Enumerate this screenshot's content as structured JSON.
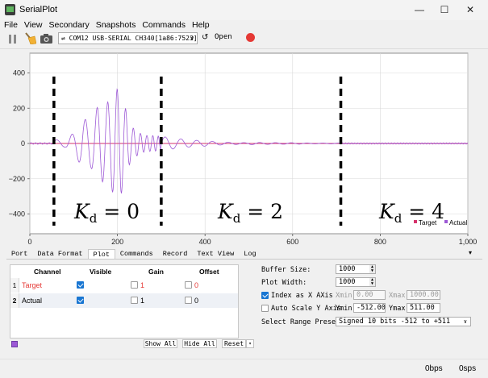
{
  "window": {
    "title": "SerialPlot"
  },
  "menu": [
    "File",
    "View",
    "Secondary",
    "Snapshots",
    "Commands",
    "Help"
  ],
  "toolbar": {
    "port_value": "COM12 USB-SERIAL CH340[1a86:7523]",
    "open_label": "Open",
    "refresh_glyph": "↺"
  },
  "window_controls": {
    "minimize": "—",
    "maximize": "☐",
    "close": "✕"
  },
  "plot": {
    "y_ticks": [
      "400",
      "200",
      "0",
      "−200",
      "−400"
    ],
    "x_ticks": [
      "0",
      "200",
      "400",
      "600",
      "800",
      "1,000"
    ],
    "annotations": [
      {
        "subscript": "d",
        "value": "0"
      },
      {
        "subscript": "d",
        "value": "2"
      },
      {
        "subscript": "d",
        "value": "4"
      }
    ],
    "legend": {
      "target": "Target",
      "actual": "Actual"
    }
  },
  "chart_data": {
    "type": "line",
    "xlim": [
      0,
      1000
    ],
    "ylim": [
      -512,
      512
    ],
    "series": [
      {
        "name": "Target",
        "color": "#d6336c",
        "x": [
          0,
          1000
        ],
        "y": [
          0,
          0
        ]
      },
      {
        "name": "Actual",
        "color": "#9d59d6",
        "x": [
          55,
          80,
          100,
          120,
          140,
          155,
          175,
          195,
          205,
          215,
          230,
          250,
          265,
          280,
          300,
          320,
          340,
          360,
          380,
          400,
          420,
          440,
          460,
          500,
          550,
          600,
          650,
          700,
          710,
          800,
          900,
          1000
        ],
        "y": [
          0,
          20,
          -60,
          -135,
          140,
          -210,
          225,
          -300,
          320,
          -230,
          100,
          -60,
          45,
          -45,
          40,
          -35,
          30,
          -25,
          22,
          -20,
          15,
          -12,
          10,
          -8,
          6,
          -5,
          3,
          0,
          0,
          0,
          0,
          0
        ]
      }
    ],
    "vertical_markers_x": [
      55,
      300,
      710
    ],
    "legend_position": "bottom-right",
    "grid": true
  },
  "tabs": {
    "items": [
      "Port",
      "Data Format",
      "Plot",
      "Commands",
      "Record",
      "Text View",
      "Log"
    ],
    "active": "Plot",
    "more_arrow": "▾"
  },
  "channels": {
    "headers": {
      "channel": "Channel",
      "visible": "Visible",
      "gain": "Gain",
      "offset": "Offset"
    },
    "rows": [
      {
        "num": "1",
        "name": "Target",
        "name_color": "#e53935",
        "visible": true,
        "gain": "1",
        "offset": "0",
        "value_color": "#e53935"
      },
      {
        "num": "2",
        "name": "Actual",
        "name_color": "#000000",
        "visible": true,
        "gain": "1",
        "offset": "0",
        "value_color": "#000000"
      }
    ],
    "buttons": {
      "show_all": "Show All",
      "hide_all": "Hide All",
      "reset": "Reset"
    },
    "swatch_color": "#9d59d6"
  },
  "settings": {
    "buffer_size_label": "Buffer Size:",
    "buffer_size": "1000",
    "plot_width_label": "Plot Width:",
    "plot_width": "1000",
    "index_x_label": "Index as X AXis",
    "index_x_checked": true,
    "xmin_label": "Xmin",
    "xmin": "0.00",
    "xmax_label": "Xmax",
    "xmax": "1000.00",
    "auto_scale_label": "Auto Scale Y Axis",
    "auto_scale_checked": false,
    "ymin_label": "Ymin",
    "ymin": "-512.00",
    "ymax_label": "Ymax",
    "ymax": "511.00",
    "range_preset_label": "Select Range Preset:",
    "range_preset": "Signed 10 bits -512 to +511"
  },
  "status": {
    "left": "0bps",
    "right": "0sps"
  }
}
